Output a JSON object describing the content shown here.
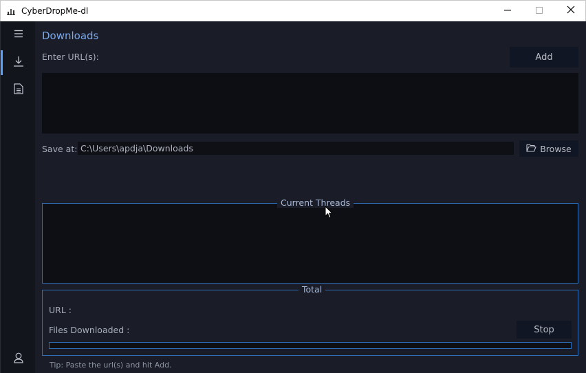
{
  "window": {
    "title": "CyberDropMe-dl",
    "icons": {
      "minimize": "minimize-icon",
      "maximize": "maximize-icon",
      "close": "close-icon"
    }
  },
  "sidebar": {
    "items": [
      {
        "icon": "hamburger-menu-icon"
      },
      {
        "icon": "download-icon",
        "active": true
      },
      {
        "icon": "document-icon"
      },
      {
        "icon": "user-icon"
      }
    ]
  },
  "downloads": {
    "title": "Downloads",
    "url_label": "Enter URL(s):",
    "add_label": "Add",
    "url_value": "",
    "save_label": "Save at:",
    "save_path": "C:\\Users\\apdja\\Downloads",
    "browse_label": "Browse",
    "browse_icon": "folder-open-icon"
  },
  "threads": {
    "legend": "Current Threads"
  },
  "total": {
    "legend": "Total",
    "url_label": "URL :",
    "files_label": "Files Downloaded :",
    "stop_label": "Stop",
    "progress": 0
  },
  "tip": "Tip: Paste the url(s) and hit Add.",
  "colors": {
    "accent": "#2e6fb8",
    "title_accent": "#7aa8ee",
    "background": "#1a1d27",
    "sidebar": "#13151d"
  }
}
